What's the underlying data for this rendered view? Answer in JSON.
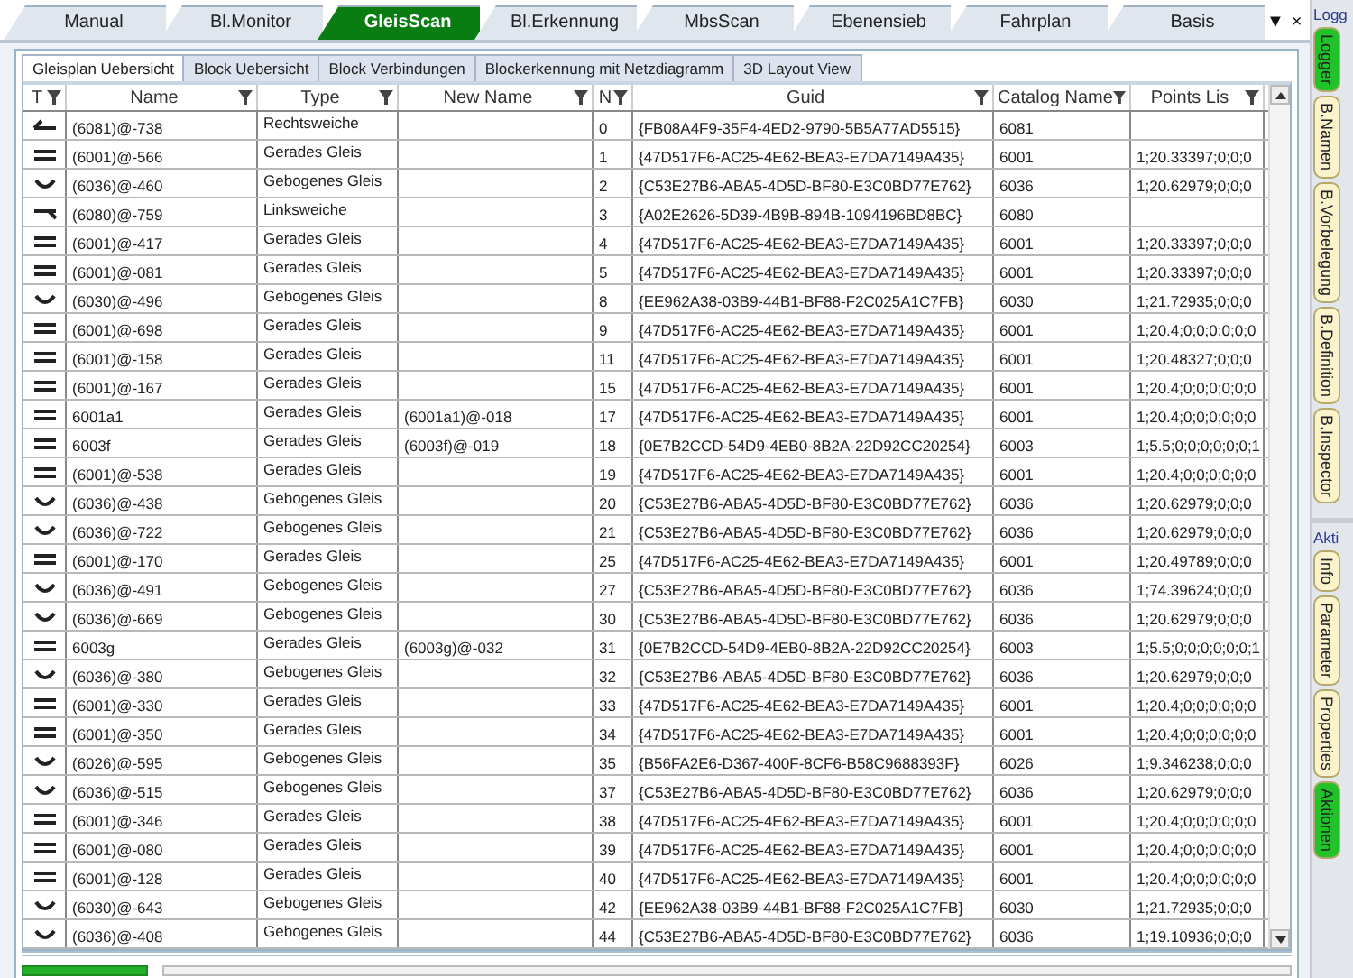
{
  "tabs": [
    {
      "label": "Manual",
      "selected": false
    },
    {
      "label": "Bl.Monitor",
      "selected": false
    },
    {
      "label": "GleisScan",
      "selected": true
    },
    {
      "label": "Bl.Erkennung",
      "selected": false
    },
    {
      "label": "MbsScan",
      "selected": false
    },
    {
      "label": "Ebenensieb",
      "selected": false
    },
    {
      "label": "Fahrplan",
      "selected": false
    },
    {
      "label": "Basis",
      "selected": false
    }
  ],
  "tab_menu": {
    "dropdown": "▼",
    "close": "×"
  },
  "subtabs": [
    {
      "label": "Gleisplan Uebersicht",
      "selected": true
    },
    {
      "label": "Block Uebersicht",
      "selected": false
    },
    {
      "label": "Block Verbindungen",
      "selected": false
    },
    {
      "label": "Blockerkennung mit Netzdiagramm",
      "selected": false
    },
    {
      "label": "3D Layout View",
      "selected": false
    }
  ],
  "table": {
    "columns": [
      "T",
      "Name",
      "Type",
      "New Name",
      "N",
      "Guid",
      "Catalog Name",
      "Points Lis"
    ],
    "rows": [
      {
        "kind": "right-switch",
        "name": "(6081)@-738",
        "type": "Rechtsweiche",
        "n": "0",
        "guid": "{FB08A4F9-35F4-4ED2-9790-5B5A77AD5515}",
        "catalog": "6081"
      },
      {
        "kind": "straight",
        "name": "(6001)@-566",
        "type": "Gerades Gleis",
        "n": "1",
        "guid": "{47D517F6-AC25-4E62-BEA3-E7DA7149A435}",
        "catalog": "6001",
        "points": "1;20.33397;0;0;0"
      },
      {
        "kind": "curved",
        "name": "(6036)@-460",
        "type": "Gebogenes Gleis",
        "n": "2",
        "guid": "{C53E27B6-ABA5-4D5D-BF80-E3C0BD77E762}",
        "catalog": "6036",
        "points": "1;20.62979;0;0;0"
      },
      {
        "kind": "left-switch",
        "name": "(6080)@-759",
        "type": "Linksweiche",
        "n": "3",
        "guid": "{A02E2626-5D39-4B9B-894B-1094196BD8BC}",
        "catalog": "6080"
      },
      {
        "kind": "straight",
        "name": "(6001)@-417",
        "type": "Gerades Gleis",
        "n": "4",
        "guid": "{47D517F6-AC25-4E62-BEA3-E7DA7149A435}",
        "catalog": "6001",
        "points": "1;20.33397;0;0;0"
      },
      {
        "kind": "straight",
        "name": "(6001)@-081",
        "type": "Gerades Gleis",
        "n": "5",
        "guid": "{47D517F6-AC25-4E62-BEA3-E7DA7149A435}",
        "catalog": "6001",
        "points": "1;20.33397;0;0;0"
      },
      {
        "kind": "curved",
        "name": "(6030)@-496",
        "type": "Gebogenes Gleis",
        "n": "8",
        "guid": "{EE962A38-03B9-44B1-BF88-F2C025A1C7FB}",
        "catalog": "6030",
        "points": "1;21.72935;0;0;0"
      },
      {
        "kind": "straight",
        "name": "(6001)@-698",
        "type": "Gerades Gleis",
        "n": "9",
        "guid": "{47D517F6-AC25-4E62-BEA3-E7DA7149A435}",
        "catalog": "6001",
        "points": "1;20.4;0;0;0;0;0;0"
      },
      {
        "kind": "straight",
        "name": "(6001)@-158",
        "type": "Gerades Gleis",
        "n": "11",
        "guid": "{47D517F6-AC25-4E62-BEA3-E7DA7149A435}",
        "catalog": "6001",
        "points": "1;20.48327;0;0;0"
      },
      {
        "kind": "straight",
        "name": "(6001)@-167",
        "type": "Gerades Gleis",
        "n": "15",
        "guid": "{47D517F6-AC25-4E62-BEA3-E7DA7149A435}",
        "catalog": "6001",
        "points": "1;20.4;0;0;0;0;0;0"
      },
      {
        "kind": "straight",
        "name": "6001a1",
        "type": "Gerades Gleis",
        "new_name": "(6001a1)@-018",
        "n": "17",
        "guid": "{47D517F6-AC25-4E62-BEA3-E7DA7149A435}",
        "catalog": "6001",
        "points": "1;20.4;0;0;0;0;0;0"
      },
      {
        "kind": "straight",
        "name": "6003f",
        "type": "Gerades Gleis",
        "new_name": "(6003f)@-019",
        "n": "18",
        "guid": "{0E7B2CCD-54D9-4EB0-8B2A-22D92CC20254}",
        "catalog": "6003",
        "points": "1;5.5;0;0;0;0;0;0;1"
      },
      {
        "kind": "straight",
        "name": "(6001)@-538",
        "type": "Gerades Gleis",
        "n": "19",
        "guid": "{47D517F6-AC25-4E62-BEA3-E7DA7149A435}",
        "catalog": "6001",
        "points": "1;20.4;0;0;0;0;0;0"
      },
      {
        "kind": "curved",
        "name": "(6036)@-438",
        "type": "Gebogenes Gleis",
        "n": "20",
        "guid": "{C53E27B6-ABA5-4D5D-BF80-E3C0BD77E762}",
        "catalog": "6036",
        "points": "1;20.62979;0;0;0"
      },
      {
        "kind": "curved",
        "name": "(6036)@-722",
        "type": "Gebogenes Gleis",
        "n": "21",
        "guid": "{C53E27B6-ABA5-4D5D-BF80-E3C0BD77E762}",
        "catalog": "6036",
        "points": "1;20.62979;0;0;0"
      },
      {
        "kind": "straight",
        "name": "(6001)@-170",
        "type": "Gerades Gleis",
        "n": "25",
        "guid": "{47D517F6-AC25-4E62-BEA3-E7DA7149A435}",
        "catalog": "6001",
        "points": "1;20.49789;0;0;0"
      },
      {
        "kind": "curved",
        "name": "(6036)@-491",
        "type": "Gebogenes Gleis",
        "n": "27",
        "guid": "{C53E27B6-ABA5-4D5D-BF80-E3C0BD77E762}",
        "catalog": "6036",
        "points": "1;74.39624;0;0;0"
      },
      {
        "kind": "curved",
        "name": "(6036)@-669",
        "type": "Gebogenes Gleis",
        "n": "30",
        "guid": "{C53E27B6-ABA5-4D5D-BF80-E3C0BD77E762}",
        "catalog": "6036",
        "points": "1;20.62979;0;0;0"
      },
      {
        "kind": "straight",
        "name": "6003g",
        "type": "Gerades Gleis",
        "new_name": "(6003g)@-032",
        "n": "31",
        "guid": "{0E7B2CCD-54D9-4EB0-8B2A-22D92CC20254}",
        "catalog": "6003",
        "points": "1;5.5;0;0;0;0;0;0;1"
      },
      {
        "kind": "curved",
        "name": "(6036)@-380",
        "type": "Gebogenes Gleis",
        "n": "32",
        "guid": "{C53E27B6-ABA5-4D5D-BF80-E3C0BD77E762}",
        "catalog": "6036",
        "points": "1;20.62979;0;0;0"
      },
      {
        "kind": "straight",
        "name": "(6001)@-330",
        "type": "Gerades Gleis",
        "n": "33",
        "guid": "{47D517F6-AC25-4E62-BEA3-E7DA7149A435}",
        "catalog": "6001",
        "points": "1;20.4;0;0;0;0;0;0"
      },
      {
        "kind": "straight",
        "name": "(6001)@-350",
        "type": "Gerades Gleis",
        "n": "34",
        "guid": "{47D517F6-AC25-4E62-BEA3-E7DA7149A435}",
        "catalog": "6001",
        "points": "1;20.4;0;0;0;0;0;0"
      },
      {
        "kind": "curved",
        "name": "(6026)@-595",
        "type": "Gebogenes Gleis",
        "n": "35",
        "guid": "{B56FA2E6-D367-400F-8CF6-B58C9688393F}",
        "catalog": "6026",
        "points": "1;9.346238;0;0;0"
      },
      {
        "kind": "curved",
        "name": "(6036)@-515",
        "type": "Gebogenes Gleis",
        "n": "37",
        "guid": "{C53E27B6-ABA5-4D5D-BF80-E3C0BD77E762}",
        "catalog": "6036",
        "points": "1;20.62979;0;0;0"
      },
      {
        "kind": "straight",
        "name": "(6001)@-346",
        "type": "Gerades Gleis",
        "n": "38",
        "guid": "{47D517F6-AC25-4E62-BEA3-E7DA7149A435}",
        "catalog": "6001",
        "points": "1;20.4;0;0;0;0;0;0"
      },
      {
        "kind": "straight",
        "name": "(6001)@-080",
        "type": "Gerades Gleis",
        "n": "39",
        "guid": "{47D517F6-AC25-4E62-BEA3-E7DA7149A435}",
        "catalog": "6001",
        "points": "1;20.4;0;0;0;0;0;0"
      },
      {
        "kind": "straight",
        "name": "(6001)@-128",
        "type": "Gerades Gleis",
        "n": "40",
        "guid": "{47D517F6-AC25-4E62-BEA3-E7DA7149A435}",
        "catalog": "6001",
        "points": "1;20.4;0;0;0;0;0;0"
      },
      {
        "kind": "curved",
        "name": "(6030)@-643",
        "type": "Gebogenes Gleis",
        "n": "42",
        "guid": "{EE962A38-03B9-44B1-BF88-F2C025A1C7FB}",
        "catalog": "6030",
        "points": "1;21.72935;0;0;0"
      },
      {
        "kind": "curved",
        "name": "(6036)@-408",
        "type": "Gebogenes Gleis",
        "n": "44",
        "guid": "{C53E27B6-ABA5-4D5D-BF80-E3C0BD77E762}",
        "catalog": "6036",
        "points": "1;19.10936;0;0;0"
      }
    ]
  },
  "side_panels": [
    {
      "title": "Logg",
      "tabs": [
        {
          "label": "Logger",
          "selected": true
        },
        {
          "label": "B.Namen",
          "selected": false
        },
        {
          "label": "B.Vorbelegung",
          "selected": false
        },
        {
          "label": "B.Definition",
          "selected": false
        },
        {
          "label": "B.Inspector",
          "selected": false
        }
      ]
    },
    {
      "title": "Akti",
      "tabs": [
        {
          "label": "Info",
          "selected": false
        },
        {
          "label": "Parameter",
          "selected": false
        },
        {
          "label": "Properties",
          "selected": false
        },
        {
          "label": "Aktionen",
          "selected": true
        }
      ]
    }
  ]
}
